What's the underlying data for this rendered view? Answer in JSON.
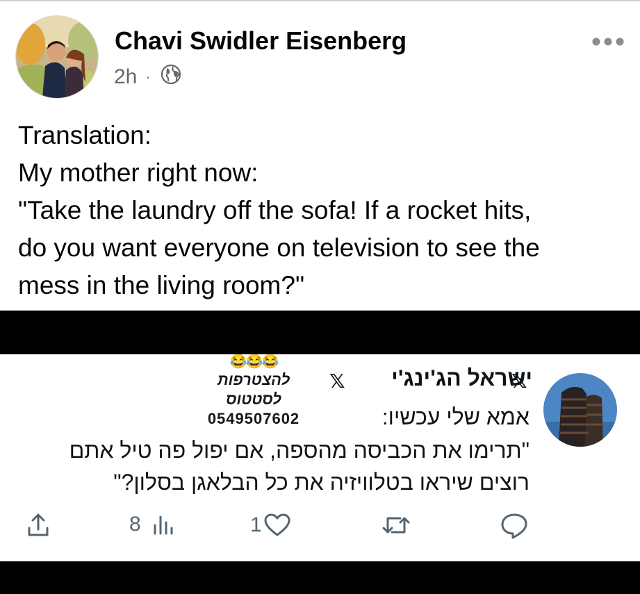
{
  "post": {
    "author": "Chavi Swidler Eisenberg",
    "time": "2h",
    "separator": "·",
    "privacy_icon": "globe-icon",
    "more_icon": "ellipsis-icon",
    "lines": [
      "Translation:",
      "My mother right now:",
      "\"Take the laundry off the sofa! If a rocket hits,",
      "do you want everyone on television to see the",
      "mess in the living room?\""
    ]
  },
  "tweet": {
    "display_name": "ישראל הג'ינג'י",
    "x_logo": "𝕏",
    "promo": {
      "emoji": "😂😂😂",
      "line1": "להצטרפות",
      "line2": "לסטטוס",
      "phone": "0549507602"
    },
    "lines": [
      "אמא שלי עכשיו:",
      "\"תרימו את הכביסה מהספה, אם יפול פה טיל אתם",
      "רוצים שיראו בטלוויזיה את כל הבלאגן בסלון?\""
    ],
    "actions": {
      "reply_icon": "comment-icon",
      "retweet_icon": "retweet-icon",
      "like_icon": "heart-icon",
      "like_count": "1",
      "views_icon": "bar-chart-icon",
      "views_count": "8",
      "share_icon": "share-icon"
    }
  },
  "colors": {
    "text_primary": "#050505",
    "text_secondary": "#65676b",
    "icon_gray": "#536471",
    "band": "#000000"
  }
}
